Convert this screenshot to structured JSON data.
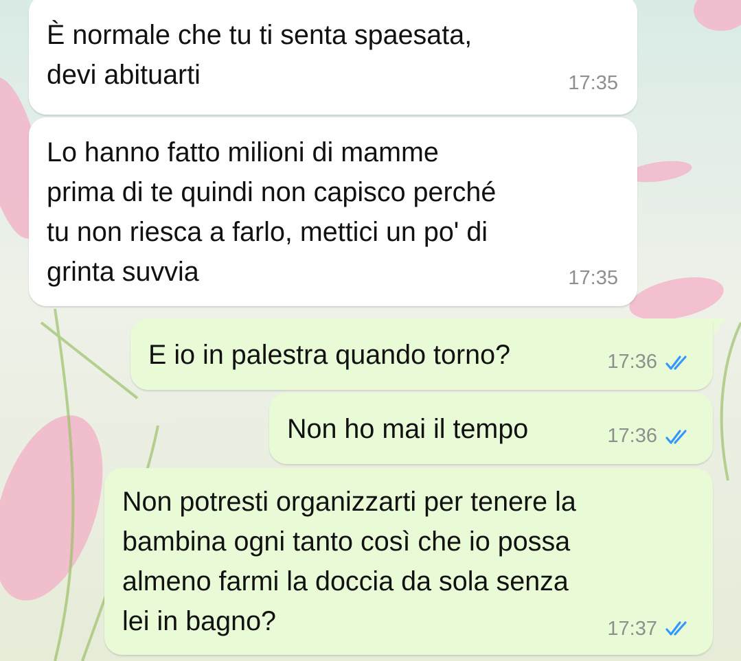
{
  "messages": [
    {
      "direction": "incoming",
      "text": "È normale che tu ti senta spaesata,\ndevi abituarti",
      "time": "17:35"
    },
    {
      "direction": "incoming",
      "text": "Lo hanno fatto milioni di mamme\nprima di te quindi non capisco perché\ntu non riesca a farlo, mettici un po' di\ngrinta suvvia",
      "time": "17:35"
    },
    {
      "direction": "outgoing",
      "text": "E io in palestra quando torno?",
      "time": "17:36",
      "status_icon": "double-check-read-icon"
    },
    {
      "direction": "outgoing",
      "text": "Non ho mai il tempo",
      "time": "17:36",
      "status_icon": "double-check-read-icon"
    },
    {
      "direction": "outgoing",
      "text": "Non potresti organizzarti per tenere la\nbambina ogni tanto così che io possa\nalmeno farmi la doccia da sola senza\nlei in bagno?",
      "time": "17:37",
      "status_icon": "double-check-read-icon"
    }
  ],
  "colors": {
    "incoming_bubble": "#ffffff",
    "outgoing_bubble": "#e8fbd6",
    "timestamp": "#8c8f8d",
    "read_ticks": "#3497f9"
  }
}
